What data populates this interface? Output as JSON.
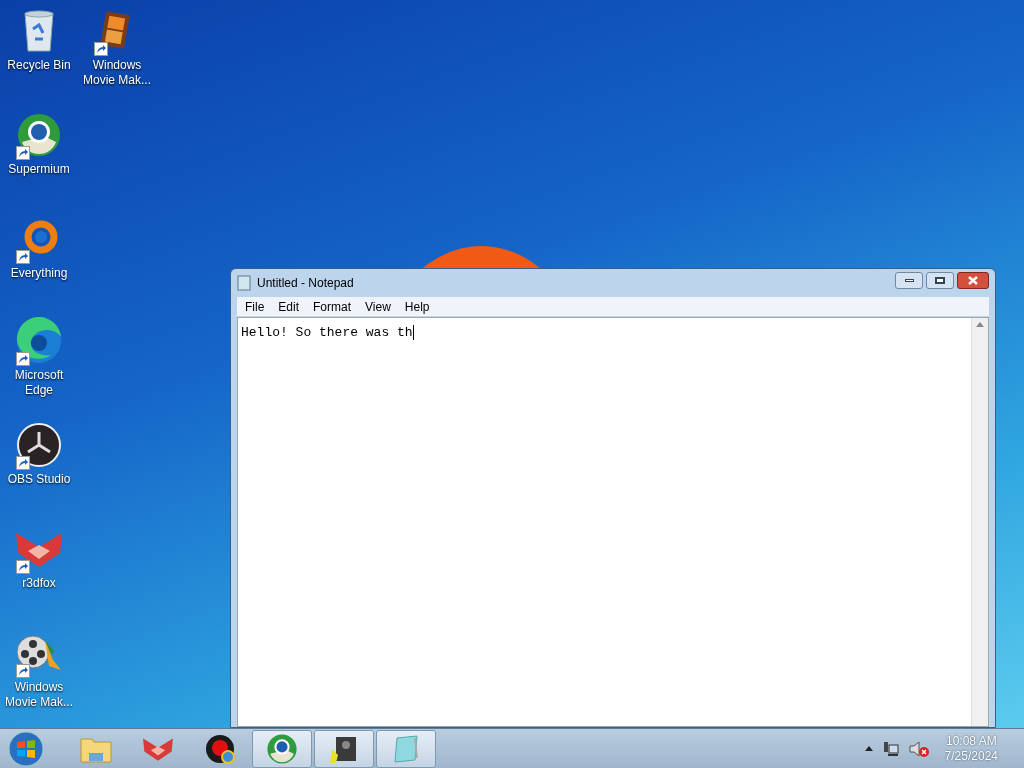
{
  "desktop_icons": [
    {
      "label": "Recycle Bin",
      "shortcut": false
    },
    {
      "label": "Windows Movie Mak...",
      "shortcut": true
    },
    {
      "label": "Supermium",
      "shortcut": true
    },
    {
      "label": "Everything",
      "shortcut": true
    },
    {
      "label": "Microsoft Edge",
      "shortcut": true
    },
    {
      "label": "OBS Studio",
      "shortcut": true
    },
    {
      "label": "r3dfox",
      "shortcut": true
    },
    {
      "label": "Windows Movie Mak...",
      "shortcut": true
    }
  ],
  "window": {
    "title": "Untitled - Notepad",
    "menu": [
      "File",
      "Edit",
      "Format",
      "View",
      "Help"
    ],
    "content": "Hello! So there was th"
  },
  "taskbar": {
    "items": [
      {
        "running": false
      },
      {
        "running": false
      },
      {
        "running": false
      },
      {
        "running": true
      },
      {
        "running": true
      },
      {
        "running": true
      }
    ],
    "clock": {
      "time": "10:08 AM",
      "date": "7/25/2024"
    }
  }
}
